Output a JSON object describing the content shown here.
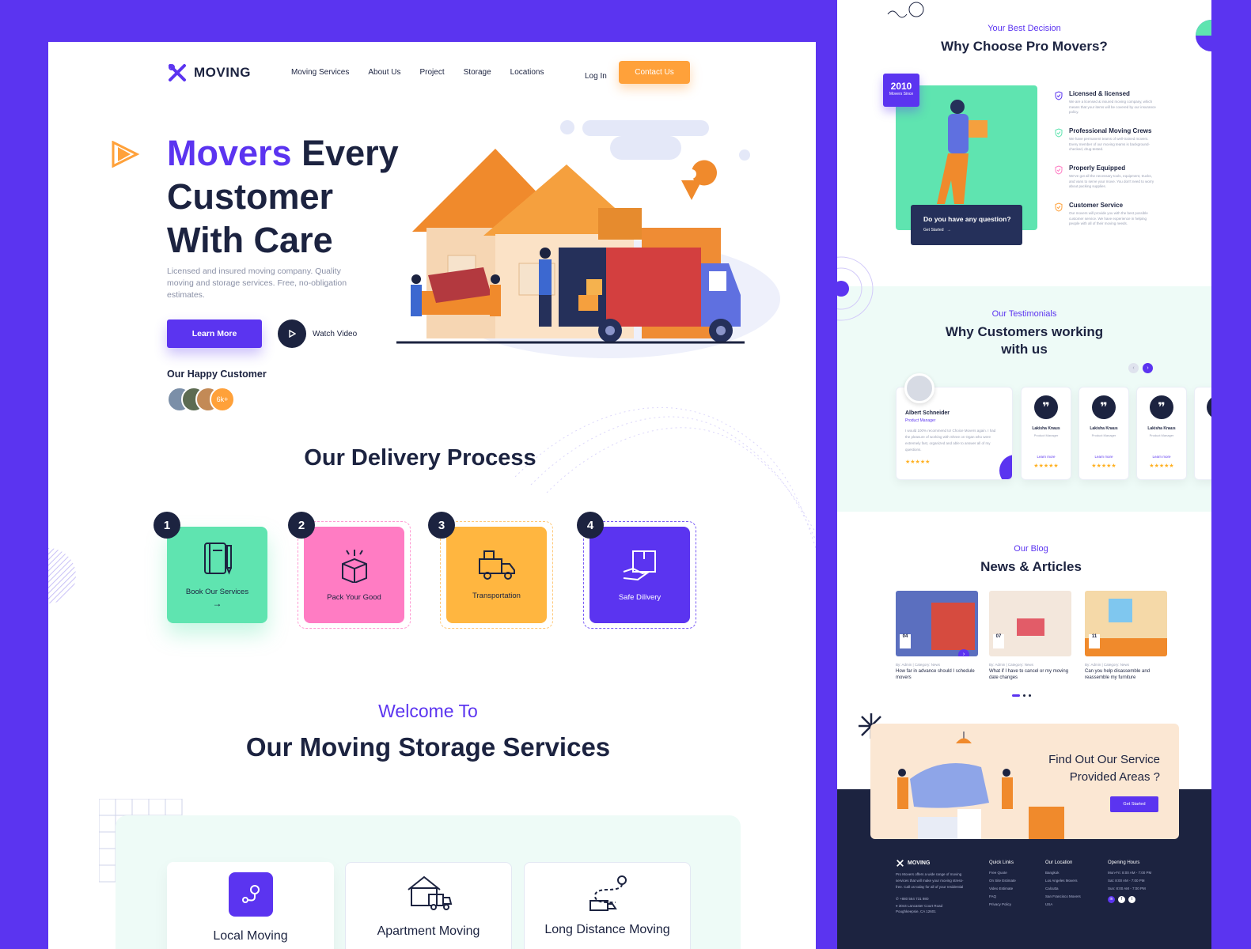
{
  "colors": {
    "primary": "#5b34f0",
    "accent": "#ffa13a",
    "dark": "#1c2340",
    "mint": "#5fe4b0",
    "pink": "#ff7cc3",
    "yellow": "#ffb640"
  },
  "brand": {
    "name": "MOVING",
    "logo_icon": "logo-mark-icon"
  },
  "nav": {
    "items": [
      "Moving Services",
      "About Us",
      "Project",
      "Storage",
      "Locations"
    ],
    "login": "Log In",
    "contact": "Contact Us"
  },
  "hero": {
    "title_accent": "Movers",
    "title_line1_rest": " Every",
    "title_line2": "Customer",
    "title_line3": "With Care",
    "description": "Licensed and insured moving company. Quality moving and storage services. Free, no-obligation estimates.",
    "learn_more": "Learn More",
    "watch_video": "Watch Video",
    "happy_customer": "Our Happy Customer",
    "customer_count": "6k+"
  },
  "delivery": {
    "heading": "Our Delivery Process",
    "steps": [
      {
        "num": "1",
        "label": "Book Our Services",
        "arrow": "→",
        "icon": "notebook-icon"
      },
      {
        "num": "2",
        "label": "Pack Your Good",
        "icon": "gift-box-icon"
      },
      {
        "num": "3",
        "label": "Transportation",
        "icon": "truck-icon"
      },
      {
        "num": "4",
        "label": "Safe Dilivery",
        "icon": "delivery-box-icon"
      }
    ]
  },
  "storage": {
    "welcome": "Welcome To",
    "heading": "Our Moving Storage Services",
    "services": [
      {
        "label": "Local Moving",
        "icon": "location-route-icon"
      },
      {
        "label": "Apartment Moving",
        "icon": "house-truck-icon"
      },
      {
        "label": "Long Distance Moving",
        "icon": "route-truck-icon"
      }
    ]
  },
  "why": {
    "eyebrow": "Your Best Decision",
    "heading": "Why Choose Pro Movers?",
    "since_year": "2010",
    "since_label": "Movers Since",
    "question": "Do you have any question?",
    "question_cta": "Get Started",
    "features": [
      {
        "title": "Licensed & licensed",
        "text": "We are a licensed & insured moving company, which means that your items will be covered by our insurance policy."
      },
      {
        "title": "Professional Moving Crews",
        "text": "We have permanent teams of well-trained movers. Every member of our moving teams is background-checked, drug-tested."
      },
      {
        "title": "Properly Equipped",
        "text": "We've got all the necessary tools, equipment, trucks, and vans to serve your move. You don't need to worry about packing supplies."
      },
      {
        "title": "Customer Service",
        "text": "Our movers will provide you with the best possible customer service. We have experience in helping people with all of their moving needs."
      }
    ]
  },
  "testimonials": {
    "eyebrow": "Our Testimonials",
    "heading_line1": "Why Customers working",
    "heading_line2": "with us",
    "main": {
      "name": "Albert Schneider",
      "role": "Product Manager",
      "text": "I would 100% recommend to! Choice Movers again. I had the pleasure of working with Shree on Ogan who were extremely fast, organized and able to answer all of my questions.",
      "stars": "★★★★★"
    },
    "cards": [
      {
        "name": "Lakisha Knaus",
        "role": "Product Manager",
        "link": "Learn more",
        "stars": "★★★★★"
      },
      {
        "name": "Lakisha Knaus",
        "role": "Product Manager",
        "link": "Learn more",
        "stars": "★★★★★"
      },
      {
        "name": "Lakisha Knaus",
        "role": "Product Manager",
        "link": "Learn more",
        "stars": "★★★★★"
      }
    ],
    "quote_glyph": "❞"
  },
  "blog": {
    "eyebrow": "Our Blog",
    "heading": "News & Articles",
    "posts": [
      {
        "day": "04",
        "month": "December",
        "meta": "By: Admin | Category: News",
        "title": "How far in advance should I schedule movers"
      },
      {
        "day": "07",
        "month": "December",
        "meta": "By: Admin | Category: News",
        "title": "What if I have to cancel or my moving date changes"
      },
      {
        "day": "11",
        "month": "December",
        "meta": "By: Admin | Category: News",
        "title": "Can you help disassemble and reassemble my furniture"
      }
    ]
  },
  "areas": {
    "line1": "Find Out Our Service",
    "line2": "Provided Areas ?",
    "cta": "Get Started"
  },
  "footer": {
    "about": "Pro Movers offers a wide range of moving services that will make your moving stress-free. Call us today for all of your residential",
    "phone": "+880 564 731 980",
    "address_line1": "3044 Lancaster Court Road",
    "address_line2": "Poughkeepsie, CA 12601",
    "quick_links_title": "Quick Links",
    "quick_links": [
      "Free Quote",
      "On Site Estimate",
      "Video Estimate",
      "FAQ",
      "Privacy Policy"
    ],
    "location_title": "Our Location",
    "locations": [
      "Bangkok",
      "Los Angeles Movers",
      "Calcutta",
      "San Francisco Movers",
      "USA"
    ],
    "hours_title": "Opening Hours",
    "hours": [
      "Mon-Fri: 8:00 AM - 7:00 PM",
      "Sat: 8:00 AM - 7:00 PM",
      "Sun: 8:00 AM - 7:00 PM"
    ]
  }
}
